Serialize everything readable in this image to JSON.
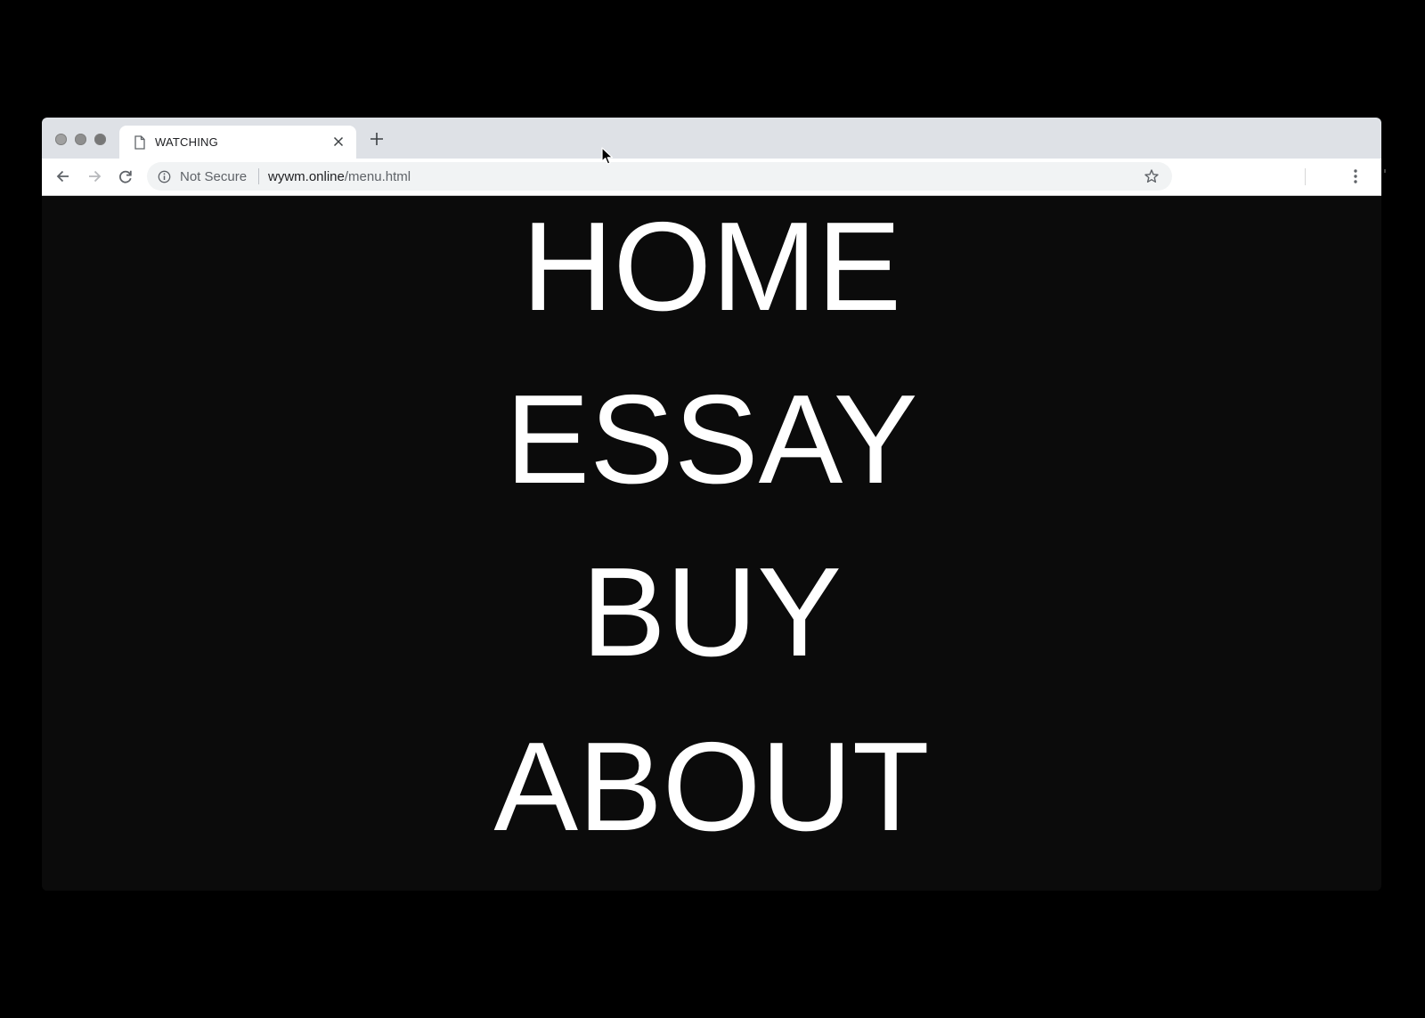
{
  "browser": {
    "tab": {
      "title": "WATCHING",
      "icon": "file-icon",
      "close_icon": "close-icon"
    },
    "new_tab_icon": "plus-icon",
    "navigation": {
      "back_icon": "arrow-left-icon",
      "forward_icon": "arrow-right-icon",
      "reload_icon": "reload-icon"
    },
    "omnibox": {
      "security_icon": "info-icon",
      "security_label": "Not Secure",
      "url_domain": "wywm.online",
      "url_path": "/menu.html",
      "bookmark_icon": "star-icon"
    },
    "menu_icon": "vertical-dots-icon",
    "colors": {
      "titlebar": "#dee1e6",
      "tab": "#ffffff",
      "page_background": "#0b0b0b",
      "page_text": "#ffffff",
      "outer_background": "#000000"
    }
  },
  "page": {
    "menu": [
      "HOME",
      "ESSAY",
      "BUY",
      "ABOUT"
    ]
  }
}
